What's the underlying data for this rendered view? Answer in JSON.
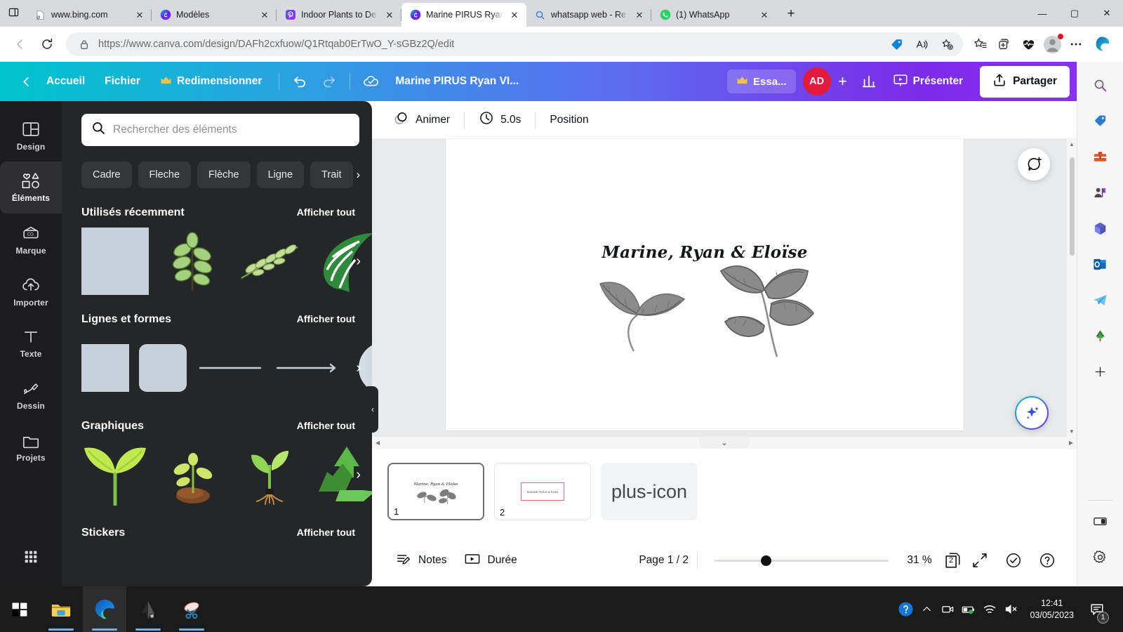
{
  "browser": {
    "tabs": [
      {
        "title": "www.bing.com",
        "favicon": "page-broken-icon",
        "active": false
      },
      {
        "title": "Modèles",
        "favicon": "canva-icon",
        "active": false
      },
      {
        "title": "Indoor Plants to De",
        "favicon": "pinterest-icon",
        "active": false
      },
      {
        "title": "Marine PIRUS Ryan",
        "favicon": "canva-icon",
        "active": true
      },
      {
        "title": "whatsapp web - Re",
        "favicon": "bing-search-icon",
        "active": false
      },
      {
        "title": "(1) WhatsApp",
        "favicon": "whatsapp-icon",
        "active": false
      }
    ],
    "new_tab_label": "+",
    "window_controls": {
      "minimize": "—",
      "maximize": "▢",
      "close": "✕"
    },
    "url_prefix": "https://",
    "url_domain": "www.canva.com",
    "url_path": "/design/DAFh2cxfuow/Q1Rtqab0ErTwO_Y-sGBz2Q/edit",
    "url_full": "https://www.canva.com/design/DAFh2cxfuow/Q1Rtqab0ErTwO_Y-sGBz2Q/edit",
    "toolbar_icons": [
      "shopping-tag-icon",
      "read-aloud-icon",
      "add-favorite-icon",
      "collections-icon",
      "split-screen-icon",
      "browser-essentials-icon",
      "profile-avatar-icon",
      "settings-more-icon"
    ]
  },
  "edge_sidebar": {
    "icons": [
      "search-icon",
      "shopping-tag-icon",
      "tools-icon",
      "games-icon",
      "microsoft-365-icon",
      "outlook-icon",
      "telegram-icon",
      "tree-icon",
      "add-app-icon"
    ],
    "bottom_icons": [
      "split-screen-icon",
      "sidebar-settings-icon"
    ]
  },
  "canva": {
    "topbar": {
      "back_icon": "chevron-left-icon",
      "home": "Accueil",
      "file": "Fichier",
      "resize": "Redimensionner",
      "resize_badge": "crown-icon",
      "undo_icon": "undo-icon",
      "redo_icon": "redo-icon",
      "saved_icon": "cloud-saved-icon",
      "design_title": "Marine PIRUS Ryan VI...",
      "try_pro": "Essa...",
      "try_pro_badge": "crown-icon",
      "avatar_initials": "AD",
      "invite_icon": "plus-icon",
      "insights_icon": "insights-bar-chart-icon",
      "present_icon": "present-screen-icon",
      "present": "Présenter",
      "share_icon": "share-upload-icon",
      "share": "Partager"
    },
    "rail": [
      {
        "label": "Design",
        "icon": "design-layout-icon",
        "active": false
      },
      {
        "label": "Éléments",
        "icon": "elements-shapes-icon",
        "active": true
      },
      {
        "label": "Marque",
        "icon": "brand-kit-icon",
        "active": false
      },
      {
        "label": "Importer",
        "icon": "upload-cloud-icon",
        "active": false
      },
      {
        "label": "Texte",
        "icon": "text-t-icon",
        "active": false
      },
      {
        "label": "Dessin",
        "icon": "draw-pencil-icon",
        "active": false
      },
      {
        "label": "Projets",
        "icon": "folder-projects-icon",
        "active": false
      },
      {
        "label": "",
        "icon": "apps-grid-icon",
        "active": false
      }
    ],
    "panel": {
      "search_placeholder": "Rechercher des éléments",
      "search_icon": "search-icon",
      "search_value": "",
      "chips": [
        "Cadre",
        "Fleche",
        "Flèche",
        "Ligne",
        "Trait"
      ],
      "chips_next_icon": "chevron-right-icon",
      "sections": [
        {
          "title": "Utilisés récemment",
          "see_all": "Afficher tout",
          "items": [
            "grey-square-shape",
            "leafy-branch-graphic",
            "olive-branch-graphic",
            "monstera-leaf-graphic"
          ]
        },
        {
          "title": "Lignes et formes",
          "see_all": "Afficher tout",
          "items": [
            "square-shape",
            "rounded-square-shape",
            "line-shape",
            "arrow-line-shape",
            "circle-gradient-shape"
          ]
        },
        {
          "title": "Graphiques",
          "see_all": "Afficher tout",
          "items": [
            "sprout-leaf-graphic",
            "seedling-soil-graphic",
            "seedling-roots-graphic",
            "recycle-arrows-graphic"
          ]
        },
        {
          "title": "Stickers",
          "see_all": "Afficher tout",
          "items": []
        }
      ],
      "collapse_icon": "chevron-left-icon"
    },
    "editor_toolbar": {
      "animate_icon": "animate-circles-icon",
      "animate": "Animer",
      "duration_icon": "clock-icon",
      "duration": "5.0s",
      "position": "Position"
    },
    "canvas": {
      "title_text": "Marine, Ryan & Eloïse",
      "comment_icon": "add-comment-icon",
      "magic_icon": "magic-sparkle-icon"
    },
    "pages": [
      {
        "number": "1",
        "selected": true,
        "preview": "title-and-leaves"
      },
      {
        "number": "2",
        "selected": false,
        "preview": "red-bordered-textbox"
      }
    ],
    "add_page_icon": "plus-icon",
    "bottom": {
      "notes_icon": "notes-pencil-icon",
      "notes": "Notes",
      "timing_icon": "timing-play-icon",
      "timing": "Durée",
      "page_indicator": "Page 1 / 2",
      "zoom_value": "31 %",
      "zoom_percent": 31,
      "pagecount_icon": "pages-stack-icon",
      "pagecount_value": "2",
      "fullscreen_icon": "expand-arrows-icon",
      "check_icon": "check-circle-icon",
      "help_icon": "help-question-icon"
    }
  },
  "taskbar": {
    "start_icon": "windows-start-icon",
    "apps": [
      {
        "name": "file-explorer-icon",
        "active": false,
        "running": true
      },
      {
        "name": "microsoft-edge-icon",
        "active": true,
        "running": true
      },
      {
        "name": "inkscape-icon",
        "active": false,
        "running": true
      },
      {
        "name": "snipping-tool-icon",
        "active": false,
        "running": true
      }
    ],
    "tray": {
      "help_icon": "help-circle-icon",
      "chevron_icon": "show-hidden-icons-icon",
      "meet_now_icon": "meet-now-icon",
      "battery_icon": "battery-charging-icon",
      "network_icon": "wifi-icon",
      "volume_icon": "volume-muted-icon",
      "time": "12:41",
      "date": "03/05/2023",
      "notification_icon": "action-center-icon",
      "notification_count": "1"
    }
  }
}
